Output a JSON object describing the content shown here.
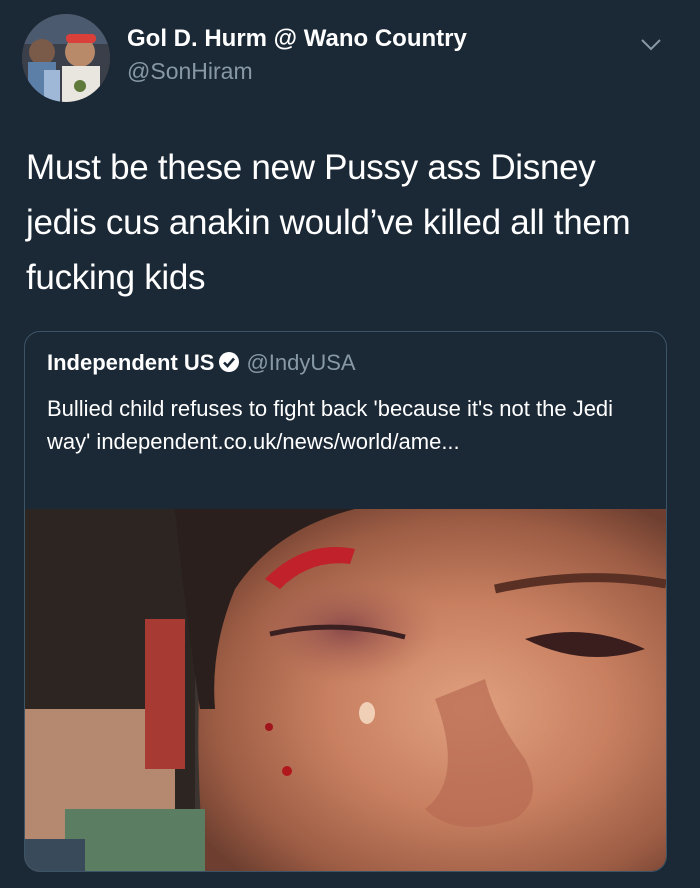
{
  "tweet": {
    "display_name": "Gol D. Hurm @ Wano Country",
    "handle": "@SonHiram",
    "text": "Must be these new Pussy ass Disney jedis cus anakin would’ve killed all them fucking kids",
    "menu_icon": "chevron-down-icon",
    "avatar_icon": "profile-photo"
  },
  "quoted_tweet": {
    "display_name": "Independent US",
    "verified_icon": "verified-badge-icon",
    "handle": "@IndyUSA",
    "text": "Bullied child refuses to fight back 'because it's not the Jedi way' independent.co.uk/news/world/ame...",
    "media": "photo-injured-child-face"
  },
  "colors": {
    "background": "#1b2836",
    "secondary_text": "#8899a6",
    "border": "#3d5466"
  }
}
